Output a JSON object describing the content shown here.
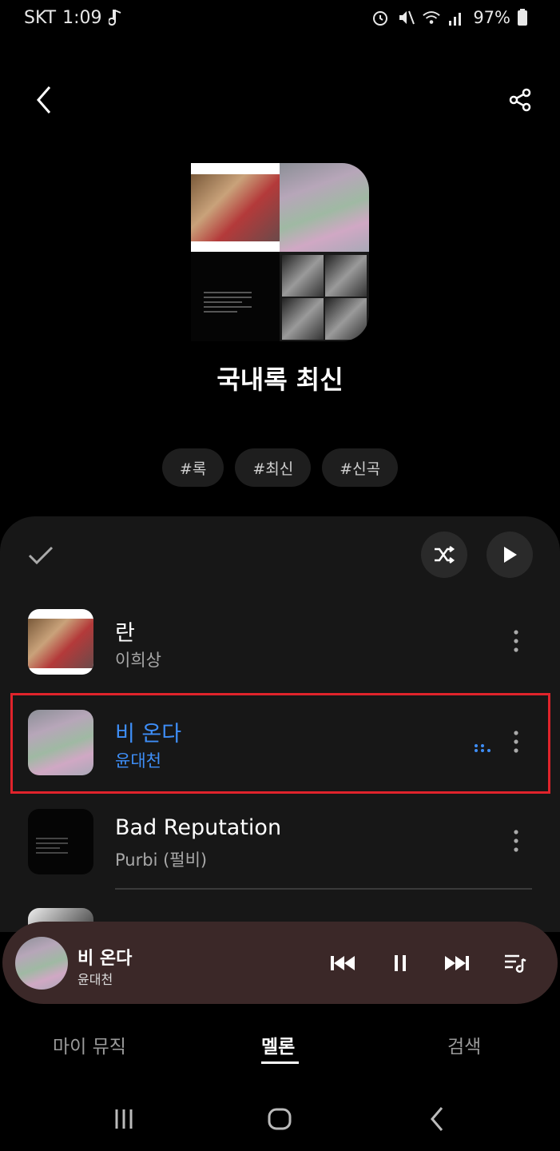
{
  "status_bar": {
    "carrier": "SKT",
    "time": "1:09",
    "battery": "97%"
  },
  "playlist": {
    "title": "국내록 최신",
    "tags": [
      "#록",
      "#최신",
      "#신곡"
    ]
  },
  "tracks": [
    {
      "title": "란",
      "artist": "이희상"
    },
    {
      "title": "비 온다",
      "artist": "윤대천"
    },
    {
      "title": "Bad Reputation",
      "artist": "Purbi (펄비)"
    }
  ],
  "mini_player": {
    "title": "비 온다",
    "artist": "윤대천"
  },
  "bottom_tabs": [
    "마이 뮤직",
    "멜론",
    "검색"
  ],
  "colors": {
    "accent": "#3e8ef7",
    "mini_player_bg": "#3b2828",
    "highlight": "#e0232b"
  }
}
